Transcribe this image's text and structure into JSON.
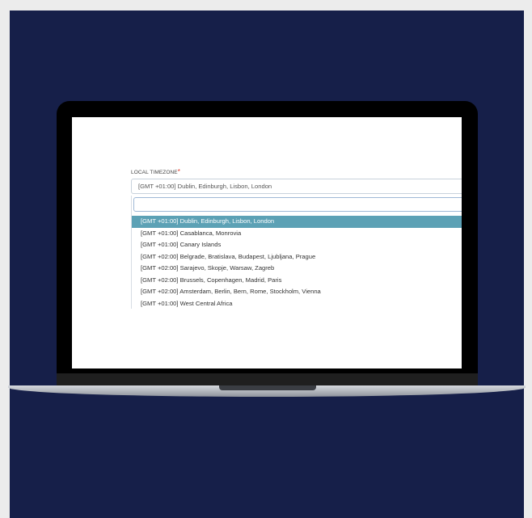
{
  "form": {
    "timezone_label": "LOCAL TIMEZONE",
    "required_mark": "*",
    "selected_value": "[GMT +01:00] Dublin, Edinburgh, Lisbon, London"
  },
  "dropdown": {
    "search_value": "",
    "options": [
      "[GMT +01:00] Dublin, Edinburgh, Lisbon, London",
      "[GMT +01:00] Casablanca, Monrovia",
      "[GMT +01:00] Canary Islands",
      "[GMT +02:00] Belgrade, Bratislava, Budapest, Ljubljana, Prague",
      "[GMT +02:00] Sarajevo, Skopje, Warsaw, Zagreb",
      "[GMT +02:00] Brussels, Copenhagen, Madrid, Paris",
      "[GMT +02:00] Amsterdam, Berlin, Bern, Rome, Stockholm, Vienna",
      "[GMT +01:00] West Central Africa"
    ],
    "highlighted_index": 0
  },
  "colors": {
    "backdrop": "#161f49",
    "highlight": "#5ca1b5",
    "required": "#e0301e"
  }
}
